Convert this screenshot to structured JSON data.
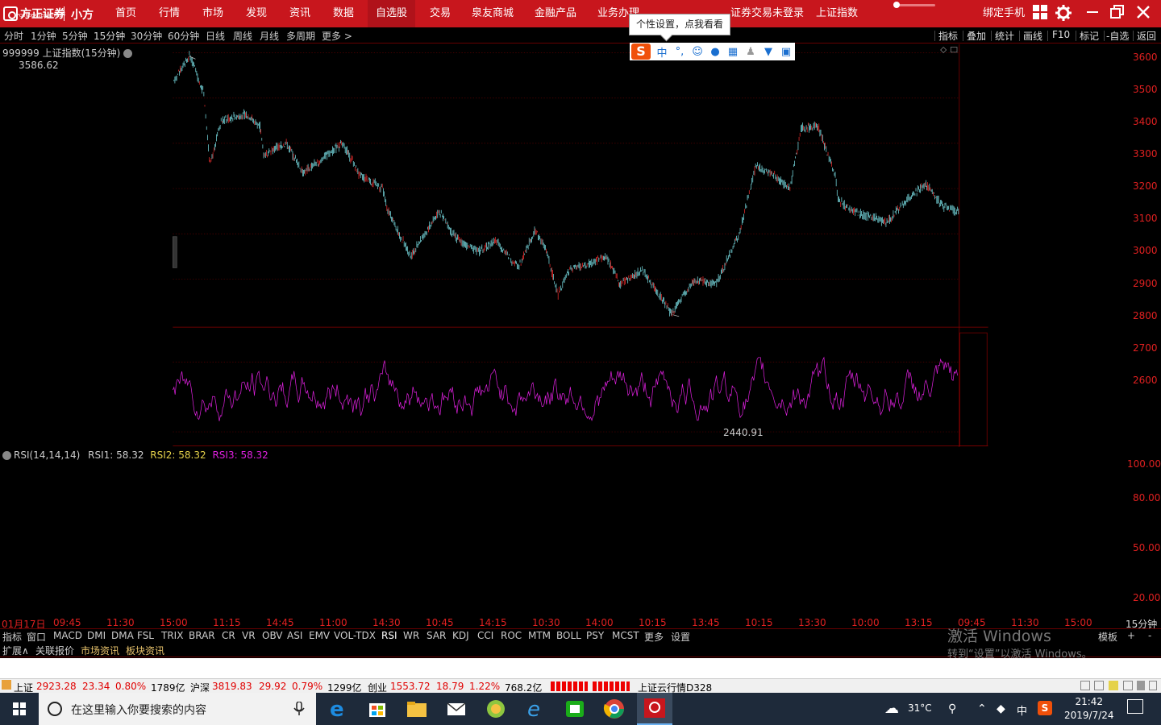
{
  "app": {
    "logo_text": "方正证券",
    "logo_sub": "FOUNDER SECURITIES",
    "logo_product": "小方",
    "nav": [
      "首页",
      "行情",
      "市场",
      "发现",
      "资讯",
      "数据",
      "自选股",
      "交易",
      "泉友商城",
      "金融产品",
      "业务办理"
    ],
    "active_nav": "自选股",
    "trade_status": "证券交易未登录",
    "current_index": "上证指数",
    "bind_phone": "绑定手机"
  },
  "periods": [
    "分时",
    "1分钟",
    "5分钟",
    "15分钟",
    "30分钟",
    "60分钟",
    "日线",
    "周线",
    "月线",
    "多周期",
    "更多 >"
  ],
  "active_period": "15分钟",
  "right_tools": [
    "指标",
    "叠加",
    "统计",
    "画线",
    "F10",
    "标记",
    "-自选",
    "返回"
  ],
  "tooltip": "个性设置，点我看看",
  "ime_icons": [
    "中",
    "°,",
    "☺",
    "mic",
    "kbd",
    "user",
    "shirt",
    "grid"
  ],
  "chart": {
    "title": "999999 上证指数(15分钟)",
    "high_label": "3586.62",
    "low_label": "2440.91",
    "price_axis": [
      "3600",
      "3500",
      "3400",
      "3300",
      "3200",
      "3100",
      "3000",
      "2900",
      "2800",
      "2700",
      "2600"
    ]
  },
  "rsi": {
    "title": "RSI(14,14,14)",
    "rsi1": "RSI1: 58.32",
    "rsi2": "RSI2: 58.32",
    "rsi3": "RSI3: 58.32",
    "axis": [
      "100.00",
      "80.00",
      "50.00",
      "20.00"
    ]
  },
  "time_axis": [
    "01月17日",
    "09:45",
    "11:30",
    "15:00",
    "11:15",
    "14:45",
    "11:00",
    "14:30",
    "10:45",
    "14:15",
    "10:30",
    "14:00",
    "10:15",
    "13:45",
    "10:15",
    "13:30",
    "10:00",
    "13:15",
    "09:45",
    "11:30",
    "15:00"
  ],
  "time_period": "15分钟",
  "indicators": [
    "指标",
    "窗口",
    "MACD",
    "DMI",
    "DMA",
    "FSL",
    "TRIX",
    "BRAR",
    "CR",
    "VR",
    "OBV",
    "ASI",
    "EMV",
    "VOL-TDX",
    "RSI",
    "WR",
    "SAR",
    "KDJ",
    "CCI",
    "ROC",
    "MTM",
    "BOLL",
    "PSY",
    "MCST",
    "更多",
    "设置"
  ],
  "active_indicator": "RSI",
  "template_btn": "模板",
  "plus_btn": "+",
  "minus_btn": "-",
  "ext_tabs": [
    "扩展∧",
    "关联报价",
    "市场资讯",
    "板块资讯"
  ],
  "watermark": {
    "line1": "激活 Windows",
    "line2": "转到“设置”以激活 Windows。"
  },
  "status_bar": {
    "sh_name": "上证",
    "sh_price": "2923.28",
    "sh_chg": "23.34",
    "sh_pct": "0.80%",
    "sh_amt": "1789亿",
    "hs_name": "沪深",
    "hs_price": "3819.83",
    "hs_chg": "29.92",
    "hs_pct": "0.79%",
    "hs_amt": "1299亿",
    "cy_name": "创业",
    "cy_price": "1553.72",
    "cy_chg": "18.79",
    "cy_pct": "1.22%",
    "cy_amt": "768.2亿",
    "cloud": "上证云行情D328"
  },
  "taskbar": {
    "search_placeholder": "在这里输入你要搜索的内容",
    "weather": "31°C",
    "ime": "中",
    "time": "21:42",
    "date": "2019/7/24"
  },
  "colors": {
    "brand_red": "#c8161d",
    "candle": "#7fe8ee",
    "rsi": "#e020e0",
    "axis": "#e02020"
  }
}
